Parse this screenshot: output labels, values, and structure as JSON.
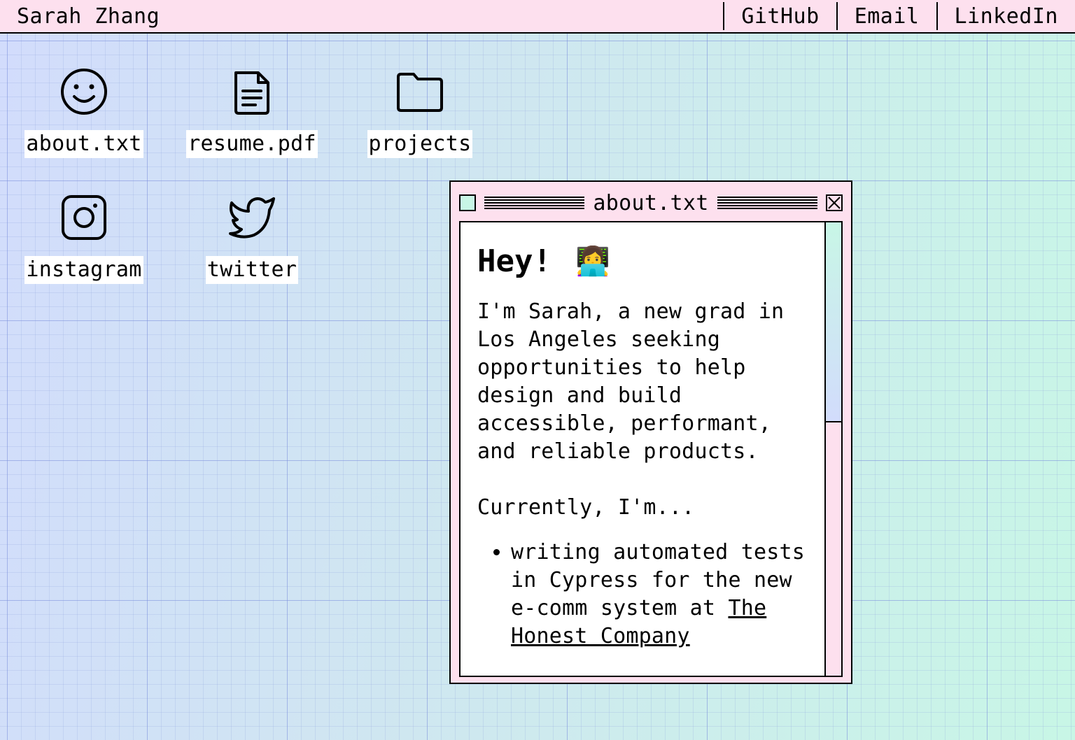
{
  "topbar": {
    "name": "Sarah Zhang",
    "links": [
      "GitHub",
      "Email",
      "LinkedIn"
    ]
  },
  "desktop": {
    "icons": [
      {
        "label": "about.txt",
        "icon": "smiley-icon"
      },
      {
        "label": "resume.pdf",
        "icon": "document-icon"
      },
      {
        "label": "projects",
        "icon": "folder-icon"
      },
      {
        "label": "instagram",
        "icon": "instagram-icon"
      },
      {
        "label": "twitter",
        "icon": "twitter-icon"
      }
    ]
  },
  "window": {
    "title": "about.txt",
    "heading": "Hey!",
    "heading_emoji": "👩‍💻",
    "intro": "I'm Sarah, a new grad in Los Angeles seeking opportunities to help design and build accessible, performant, and reliable products.",
    "currently": "Currently, I'm...",
    "items": [
      {
        "text": "writing automated tests in Cypress for the new e-comm system at ",
        "link": "The Honest Company"
      }
    ]
  },
  "colors": {
    "topbar_bg": "#fde0ee",
    "window_bg": "#fde0ee",
    "accent_mint": "#c8f6e6",
    "accent_lavender": "#d2dcfc"
  }
}
